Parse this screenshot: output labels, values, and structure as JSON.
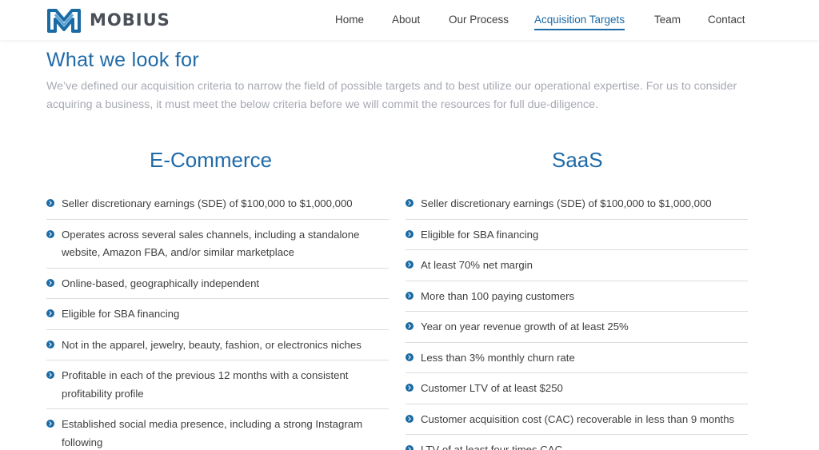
{
  "brand": {
    "name": "MOBIUS",
    "accent": "#1a6aa4"
  },
  "nav": {
    "items": [
      {
        "label": "Home"
      },
      {
        "label": "About"
      },
      {
        "label": "Our Process"
      },
      {
        "label": "Acquisition Targets",
        "active": true
      },
      {
        "label": "Team"
      },
      {
        "label": "Contact"
      }
    ]
  },
  "page": {
    "title": "What we look for",
    "intro": "We’ve defined our acquisition criteria to narrow the field of possible targets and to best utilize our operational expertise. For us to consider acquiring a business, it must meet the below criteria before we will commit the resources for full due-diligence."
  },
  "ecommerce": {
    "title": "E-Commerce",
    "items": [
      "Seller discretionary earnings (SDE) of $100,000 to $1,000,000",
      "Operates across several sales channels, including a standalone website, Amazon FBA, and/or similar marketplace",
      "Online-based, geographically independent",
      "Eligible for SBA financing",
      "Not in the apparel, jewelry, beauty, fashion, or electronics niches",
      "Profitable in each of the previous 12 months with a consistent profitability profile",
      "Established social media presence, including a strong Instagram following"
    ]
  },
  "saas": {
    "title": "SaaS",
    "items": [
      "Seller discretionary earnings (SDE) of $100,000 to $1,000,000",
      "Eligible for SBA financing",
      "At least 70% net margin",
      "More than 100 paying customers",
      "Year on year revenue growth of at least 25%",
      "Less than 3% monthly churn rate",
      "Customer LTV of at least $250",
      "Customer acquisition cost (CAC) recoverable in less than 9 months",
      "LTV of at least four times CAC"
    ]
  }
}
